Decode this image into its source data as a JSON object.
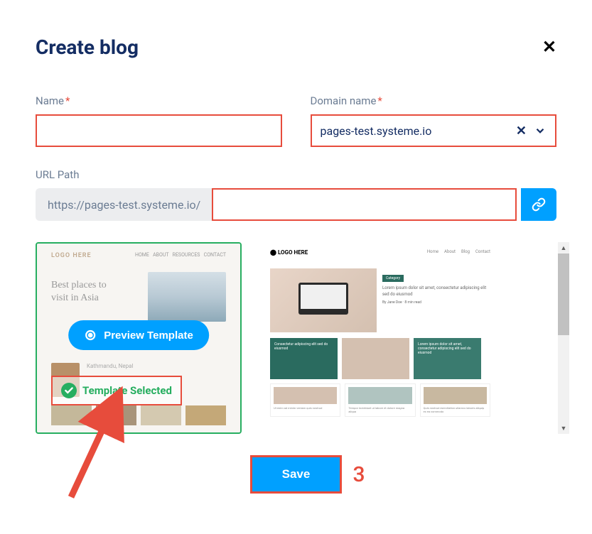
{
  "modal": {
    "title": "Create blog"
  },
  "form": {
    "name": {
      "label": "Name",
      "value": ""
    },
    "domain": {
      "label": "Domain name",
      "selected": "pages-test.systeme.io"
    },
    "url": {
      "label": "URL Path",
      "prefix": "https://pages-test.systeme.io/",
      "value": ""
    }
  },
  "templates": {
    "preview_label": "Preview Template",
    "selected_label": "Template Selected",
    "t1": {
      "logo": "LOGO HERE",
      "heading_l1": "Best places to",
      "heading_l2": "visit in Asia",
      "caption": "Kathmandu, Nepal"
    },
    "t2": {
      "logo": "⬤ LOGO HERE",
      "category": "Category",
      "lorem1": "Lorem ipsum dolor sit amet, consectetur adipiscing elit sed do eiusmod",
      "card_title": "Consectetur adipiscing elit sed do eiusmod",
      "small1": "Ut enim ad minim veniam quis nostrud",
      "small2": "Tempor incididunt ut labore et dolore magna aliqua",
      "small3": "Quis nostrud exercitation ullamco laboris aliquip ex ea commodo"
    }
  },
  "actions": {
    "save": "Save"
  },
  "annotation": {
    "number": "3"
  }
}
